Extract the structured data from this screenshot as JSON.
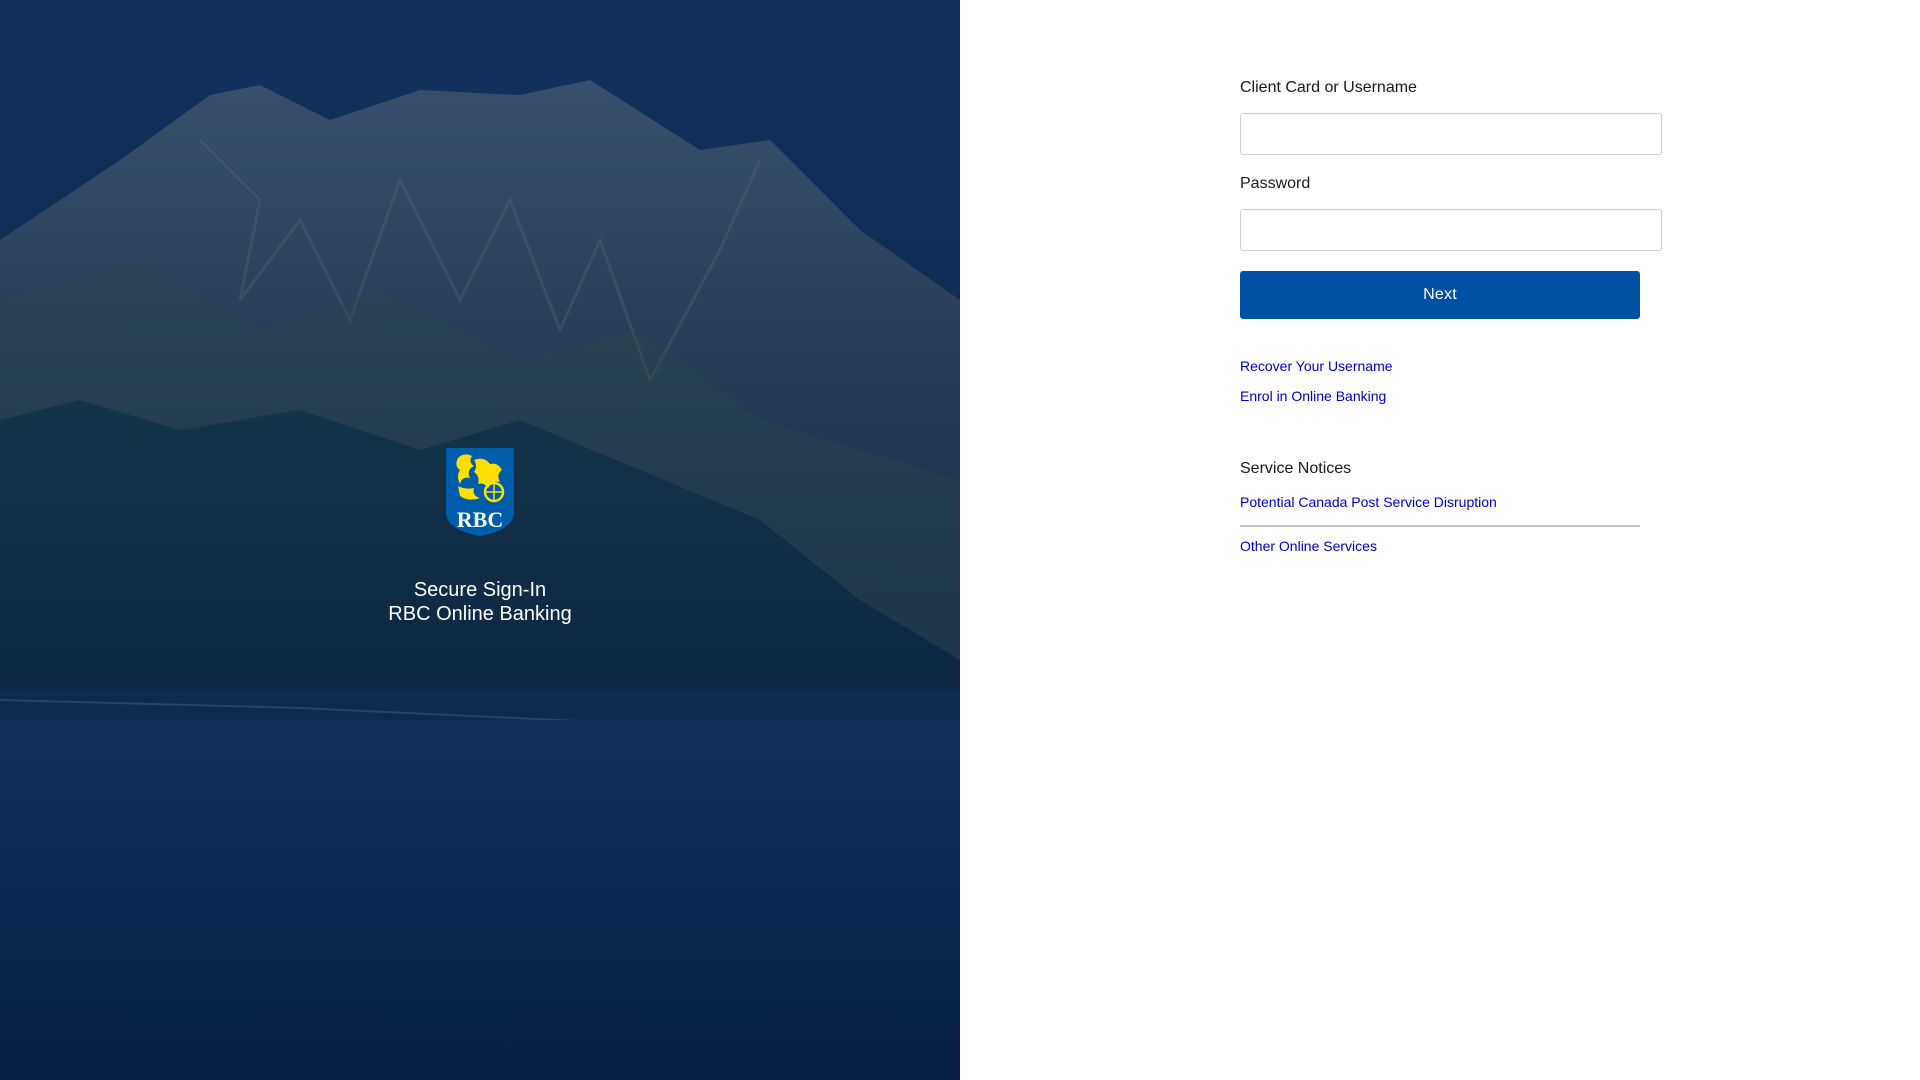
{
  "hero": {
    "logo_text": "RBC",
    "title_line1": "Secure Sign-In",
    "title_line2": "RBC Online Banking"
  },
  "form": {
    "username_label": "Client Card or Username",
    "username_value": "",
    "password_label": "Password",
    "password_value": "",
    "next_label": "Next"
  },
  "links": {
    "recover_username": "Recover Your Username",
    "enrol": "Enrol in Online Banking"
  },
  "notices": {
    "title": "Service Notices",
    "items": [
      "Potential Canada Post Service Disruption"
    ],
    "other": "Other Online Services"
  },
  "colors": {
    "primary_button": "#0051a5",
    "link": "#0000cc",
    "hero_overlay": "#0e2446",
    "logo_blue": "#005daa",
    "logo_gold": "#fedf01"
  }
}
